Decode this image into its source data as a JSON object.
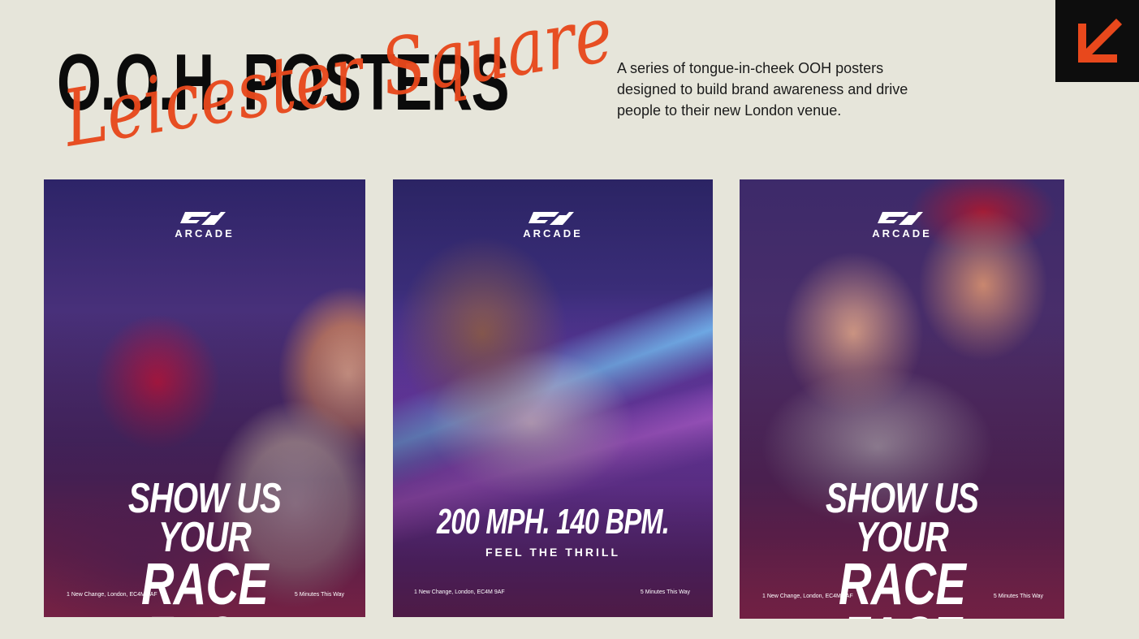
{
  "header": {
    "title": "O.O.H. POSTERS",
    "script_title": "Leicester Square",
    "description": "A series of tongue-in-cheek OOH posters designed to build brand awareness and drive people to their new London venue."
  },
  "corner_nav": {
    "icon": "arrow-down-left-icon",
    "background": "#0d0d0d",
    "arrow_color": "#e8481c"
  },
  "colors": {
    "background": "#e6e5da",
    "title": "#0b0b0b",
    "script_accent": "#e8481c"
  },
  "posters": [
    {
      "logo_text": "ARCADE",
      "headline_line1": "SHOW US YOUR",
      "headline_line2": "RACE FACE",
      "footer_left": "1 New Change, London, EC4M 9AF",
      "footer_right": "5 Minutes This Way"
    },
    {
      "logo_text": "ARCADE",
      "headline_line1": "200 MPH. 140 BPM.",
      "tagline": "FEEL THE THRILL",
      "footer_left": "1 New Change, London, EC4M 9AF",
      "footer_right": "5 Minutes This Way"
    },
    {
      "logo_text": "ARCADE",
      "headline_line1": "SHOW US YOUR",
      "headline_line2": "RACE FACE",
      "footer_left": "1 New Change, London, EC4M 9AF",
      "footer_right": "5 Minutes This Way"
    }
  ]
}
